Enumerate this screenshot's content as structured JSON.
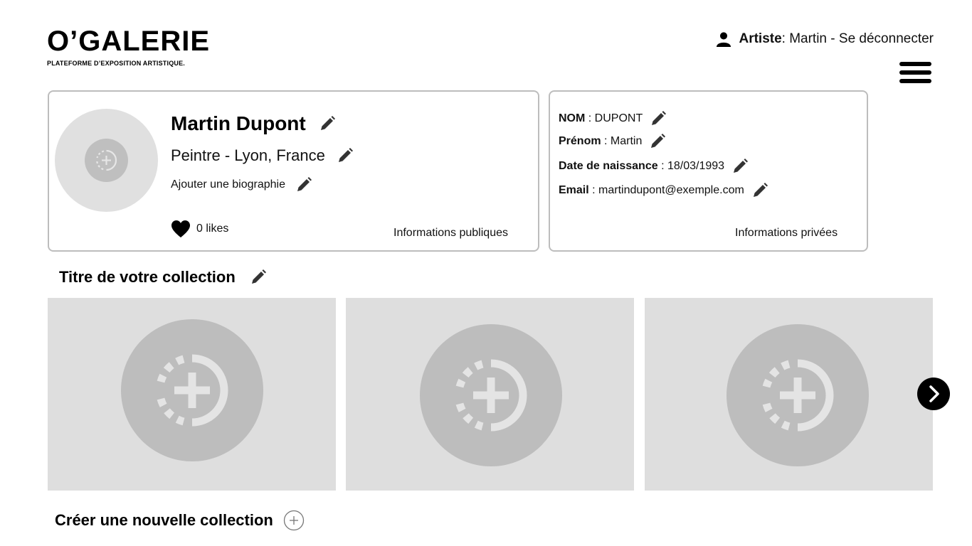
{
  "header": {
    "logo_title": "O’GALERIE",
    "logo_subtitle": "PLATEFORME D’EXPOSITION ARTISTIQUE.",
    "role_label": "Artiste",
    "role_value": " : Martin",
    "separator": " - ",
    "logout_label": "Se déconnecter"
  },
  "profile": {
    "name": "Martin Dupont",
    "job": "Peintre - Lyon, France",
    "bio_placeholder": "Ajouter une biographie",
    "likes": "0 likes",
    "section_label": "Informations publiques"
  },
  "private_info": {
    "section_label": "Informations privées",
    "rows": [
      {
        "label": "NOM",
        "value": " : DUPONT"
      },
      {
        "label": "Prénom",
        "value": " : Martin"
      },
      {
        "label": "Date de naissance",
        "value": " : 18/03/1993"
      },
      {
        "label": "Email",
        "value": " : martindupont@exemple.com"
      }
    ]
  },
  "collection": {
    "title": "Titre de votre collection",
    "tile_count_visible": 3
  },
  "new_collection_label": "Créer une nouvelle collection",
  "colors": {
    "card_border": "#bdbdbd",
    "tile_bg": "#dedede",
    "tile_circle": "#bdbdbd",
    "icon_dark": "#333333"
  }
}
